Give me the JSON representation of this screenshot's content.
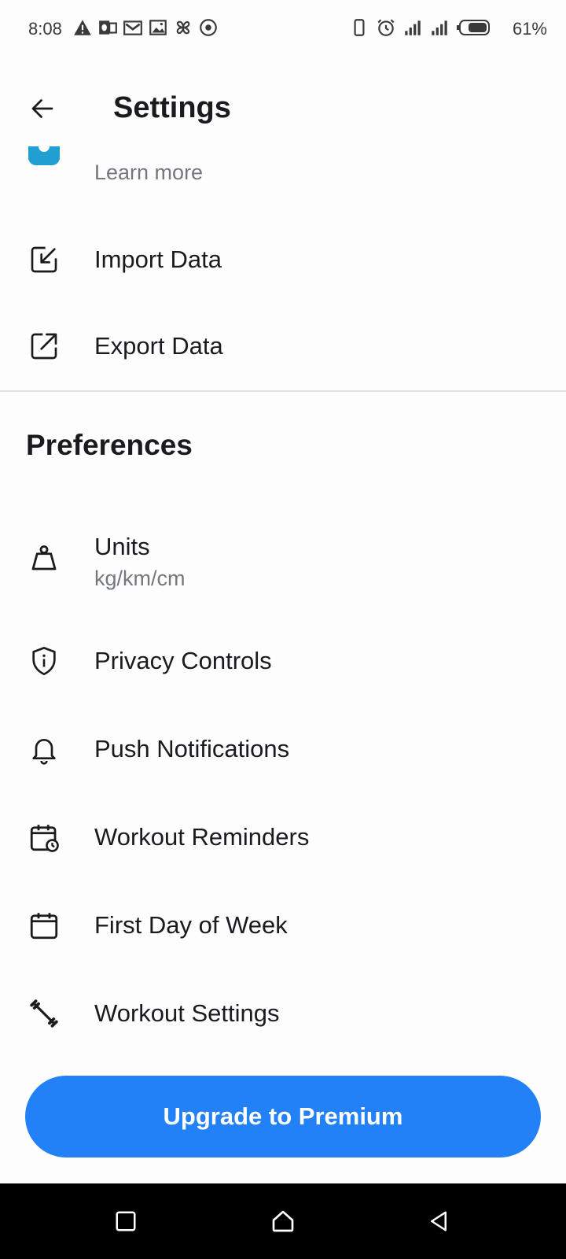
{
  "status_bar": {
    "time": "8:08",
    "battery_percent": "61%",
    "left_icons": [
      "warning-icon",
      "outlook-icon",
      "gmail-icon",
      "gallery-icon",
      "pinwheel-icon",
      "target-icon"
    ],
    "right_icons": [
      "vibrate-icon",
      "alarm-icon",
      "signal-icon",
      "signal-icon",
      "battery-icon"
    ]
  },
  "app_bar": {
    "title": "Settings",
    "back_icon": "arrow-back-icon"
  },
  "top_items": [
    {
      "label": "",
      "sublabel": "Learn more",
      "icon": "app-logo-icon"
    },
    {
      "label": "Import Data",
      "icon": "import-icon"
    },
    {
      "label": "Export Data",
      "icon": "export-icon"
    }
  ],
  "preferences": {
    "title": "Preferences",
    "items": [
      {
        "label": "Units",
        "sublabel": "kg/km/cm",
        "icon": "weight-icon"
      },
      {
        "label": "Privacy Controls",
        "icon": "shield-icon"
      },
      {
        "label": "Push Notifications",
        "icon": "bell-icon"
      },
      {
        "label": "Workout Reminders",
        "icon": "calendar-clock-icon"
      },
      {
        "label": "First Day of Week",
        "icon": "calendar-icon"
      },
      {
        "label": "Workout Settings",
        "icon": "dumbbell-icon"
      }
    ]
  },
  "cta": {
    "label": "Upgrade to Premium"
  },
  "colors": {
    "accent": "#2281f7",
    "text": "#1b1b1f",
    "secondary_text": "#74777f",
    "divider": "#e0e2e6"
  },
  "nav_bar": {
    "buttons": [
      "recents-icon",
      "home-icon",
      "back-icon"
    ]
  }
}
